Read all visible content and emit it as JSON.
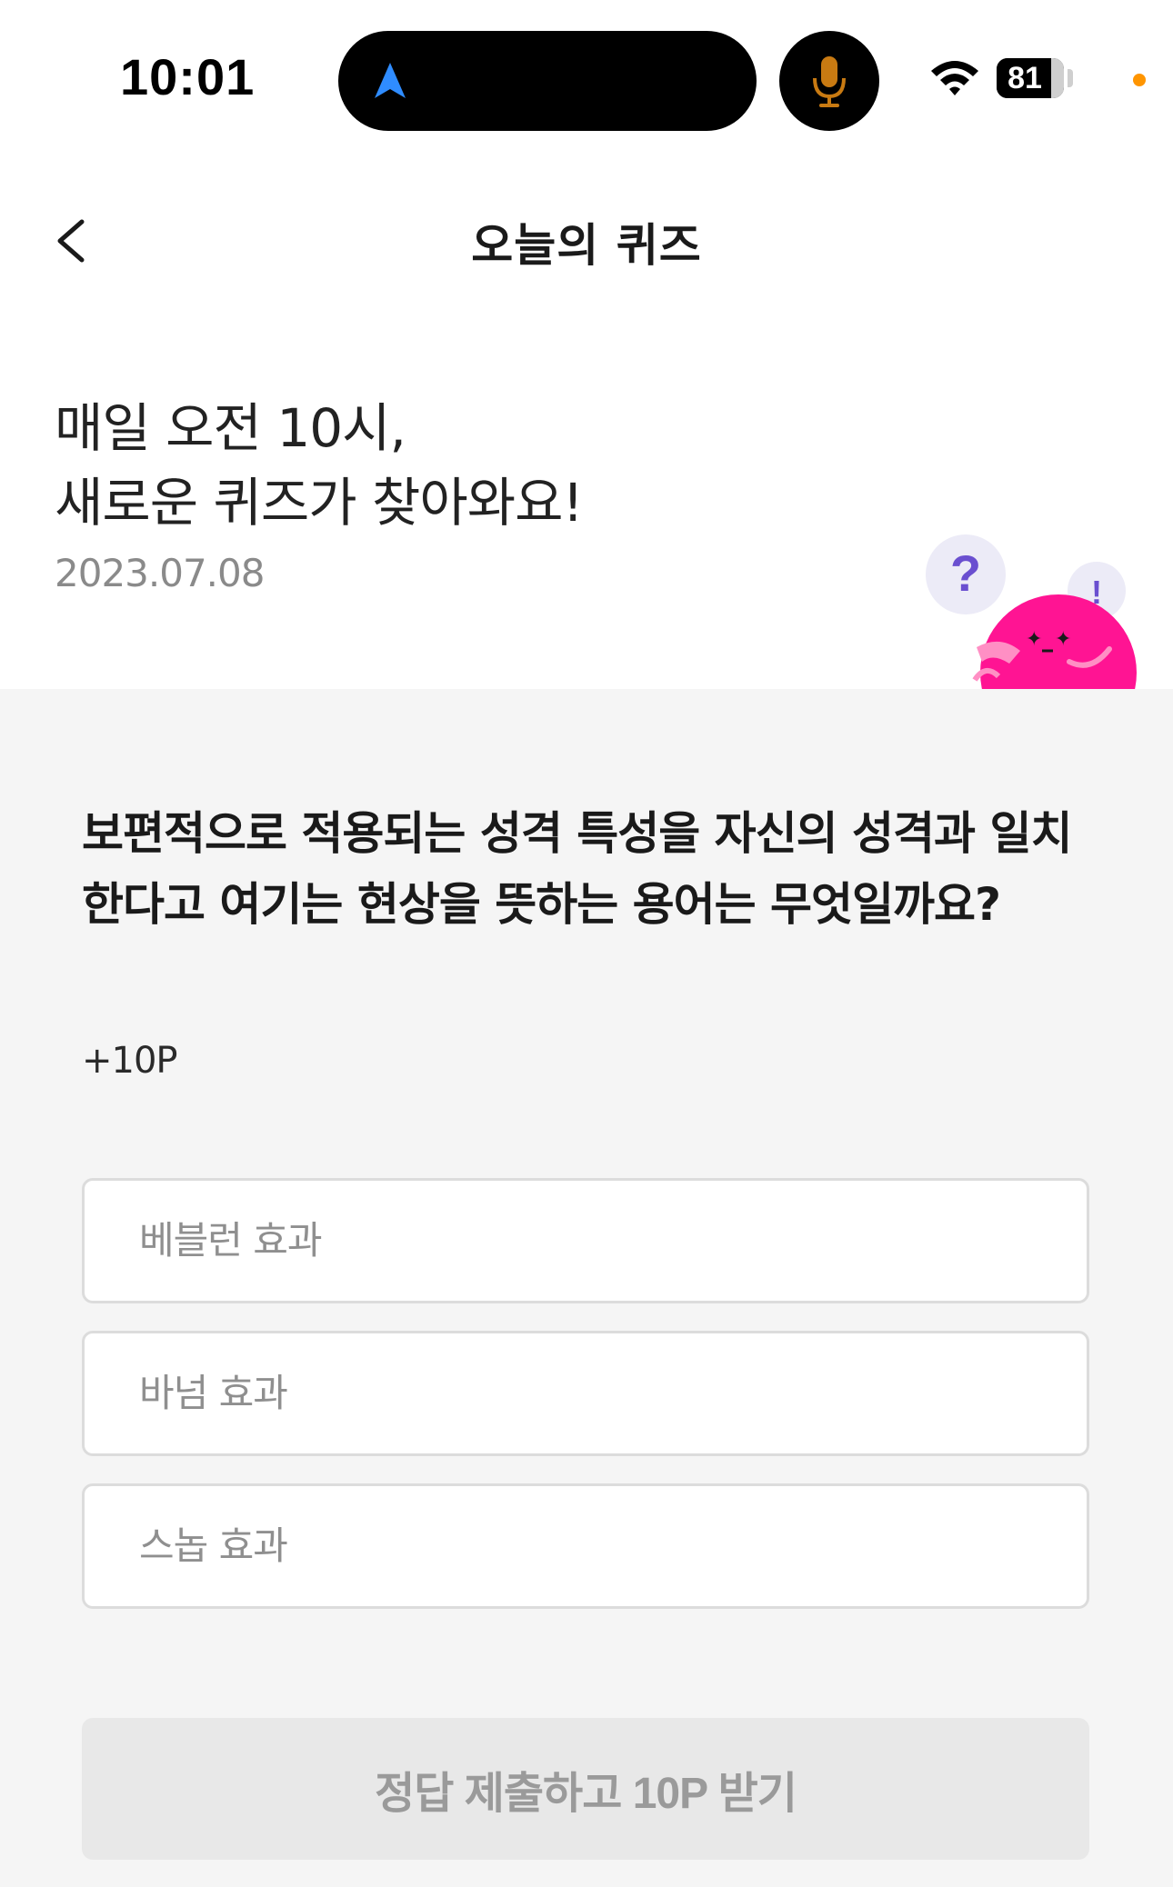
{
  "status_bar": {
    "time": "10:01",
    "battery_percent": 81,
    "battery_label": "81",
    "icons": [
      "location-arrow-icon",
      "microphone-icon",
      "wifi-icon",
      "battery-icon",
      "privacy-dot"
    ],
    "colors": {
      "nav_arrow": "#2f8cff",
      "mic": "#c87a12",
      "privacy_dot": "#ff9500"
    }
  },
  "header": {
    "back_icon": "chevron-left-icon",
    "title": "오늘의 퀴즈"
  },
  "intro": {
    "line1": "매일 오전 10시,",
    "line2": "새로운 퀴즈가 찾아와요!",
    "date": "2023.07.08"
  },
  "mascot": {
    "question_bubble": "?",
    "exclaim_bubble": "!",
    "body_color": "#ff1493"
  },
  "quiz": {
    "question": "보편적으로 적용되는 성격 특성을 자신의 성격과 일치한다고 여기는 현상을 뜻하는 용어는 무엇일까요?",
    "points": "+10P",
    "options": [
      {
        "label": "베블런 효과"
      },
      {
        "label": "바넘 효과"
      },
      {
        "label": "스놉 효과"
      }
    ],
    "submit_label": "정답 제출하고 10P 받기"
  }
}
